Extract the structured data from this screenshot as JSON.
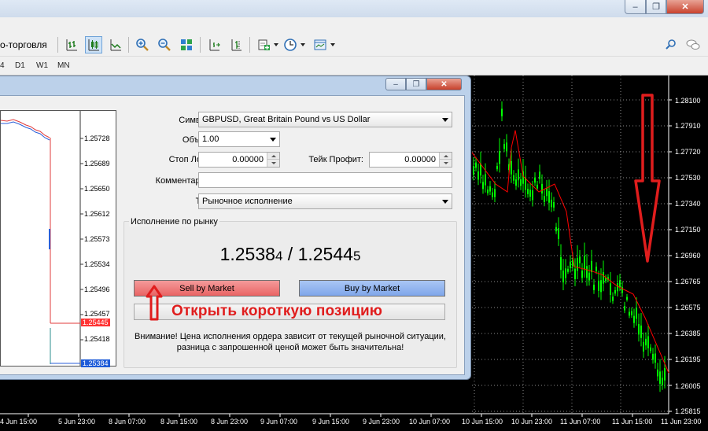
{
  "toolbar": {
    "profile_label": "о-торговля"
  },
  "timeframes": [
    "4",
    "D1",
    "W1",
    "MN"
  ],
  "dialog": {
    "symbol_label": "Символ:",
    "symbol_value": "GBPUSD, Great Britain Pound vs US Dollar",
    "volume_label": "Объем:",
    "volume_value": "1.00",
    "stop_loss_label": "Стоп Лосс:",
    "stop_loss_value": "0.00000",
    "take_profit_label": "Тейк Профит:",
    "take_profit_value": "0.00000",
    "comment_label": "Комментарий:",
    "comment_value": "",
    "type_label": "Тип:",
    "type_value": "Рыночное исполнение",
    "exec_group_title": "Исполнение по рынку",
    "bid_main": "1.2538",
    "bid_last": "4",
    "price_sep": "/",
    "ask_main": "1.2544",
    "ask_last": "5",
    "sell_label": "Sell by Market",
    "buy_label": "Buy by Market",
    "annotation": "Открыть короткую позицию",
    "warning_line1": "Внимание! Цена исполнения ордера зависит от текущей рыночной ситуации,",
    "warning_line2": "разница с запрошенной ценой может быть значительна!"
  },
  "left_chart": {
    "price_labels": [
      "1.25728",
      "1.25689",
      "1.25650",
      "1.25612",
      "1.25573",
      "1.25534",
      "1.25496",
      "1.25457",
      "1.25418"
    ],
    "ask_tag": "1.25445",
    "bid_tag": "1.25384"
  },
  "main_chart": {
    "price_labels": [
      "1.28100",
      "1.27910",
      "1.27720",
      "1.27530",
      "1.27340",
      "1.27150",
      "1.26960",
      "1.26765",
      "1.26575",
      "1.26385",
      "1.26195",
      "1.26005",
      "1.25815"
    ],
    "time_labels": [
      "4 Jun 15:00",
      "5 Jun 23:00",
      "8 Jun 07:00",
      "8 Jun 15:00",
      "8 Jun 23:00",
      "9 Jun 07:00",
      "9 Jun 15:00",
      "9 Jun 23:00",
      "10 Jun 07:00",
      "10 Jun 15:00",
      "10 Jun 23:00",
      "11 Jun 07:00",
      "11 Jun 15:00",
      "11 Jun 23:00"
    ]
  },
  "colors": {
    "candles": "#00ff00",
    "moving_average": "#ff0000",
    "sell_button": "#ee7373",
    "buy_button": "#8fb0ee",
    "annotation": "#e01d1d",
    "ask_tag": "#ff3333",
    "bid_tag": "#1e5bd8"
  }
}
